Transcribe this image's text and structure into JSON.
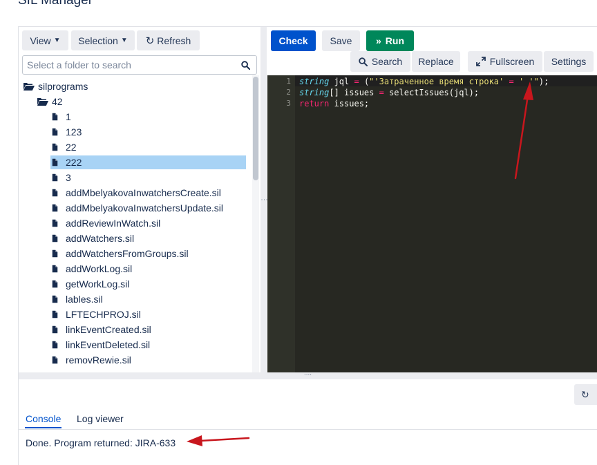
{
  "page": {
    "title": "SIL Manager"
  },
  "left_toolbar": {
    "view_label": "View",
    "selection_label": "Selection",
    "refresh_label": "Refresh"
  },
  "folder_search": {
    "placeholder": "Select a folder to search",
    "value": ""
  },
  "tree": {
    "root": "silprograms",
    "folder": "42",
    "files": [
      "1",
      "123",
      "22",
      "222",
      "3",
      "addMbelyakovaInwatchersCreate.sil",
      "addMbelyakovaInwatchersUpdate.sil",
      "addReviewInWatch.sil",
      "addWatchers.sil",
      "addWatchersFromGroups.sil",
      "addWorkLog.sil",
      "getWorkLog.sil",
      "lables.sil",
      "LFTECHPROJ.sil",
      "linkEventCreated.sil",
      "linkEventDeleted.sil",
      "removRewie.sil"
    ],
    "selected": "222"
  },
  "editor_toolbar": {
    "check_label": "Check",
    "save_label": "Save",
    "run_label": "Run",
    "search_label": "Search",
    "replace_label": "Replace",
    "fullscreen_label": "Fullscreen",
    "settings_label": "Settings"
  },
  "editor": {
    "line_numbers": [
      "1",
      "2",
      "3"
    ],
    "lines": [
      {
        "t1": "string",
        "t2": " jql ",
        "t3": "=",
        "t4": " (",
        "t5": "\"'Затраченное время строка'",
        "t6": " = ",
        "t7": "' '\"",
        "t8": ");"
      },
      {
        "t1": "string",
        "t2": "[] issues ",
        "t3": "=",
        "t4": " selectIssues(jql);"
      },
      {
        "t1": "return",
        "t2": " issues;"
      }
    ]
  },
  "bottom": {
    "tabs": [
      "Console",
      "Log viewer"
    ],
    "active_tab": "Console",
    "output": "Done. Program returned: JIRA-633"
  },
  "colors": {
    "accent": "#0052cc",
    "run": "#00875a",
    "selection": "#a8d3f5",
    "editor_bg": "#272822",
    "annotation_arrow": "#c8161d"
  }
}
